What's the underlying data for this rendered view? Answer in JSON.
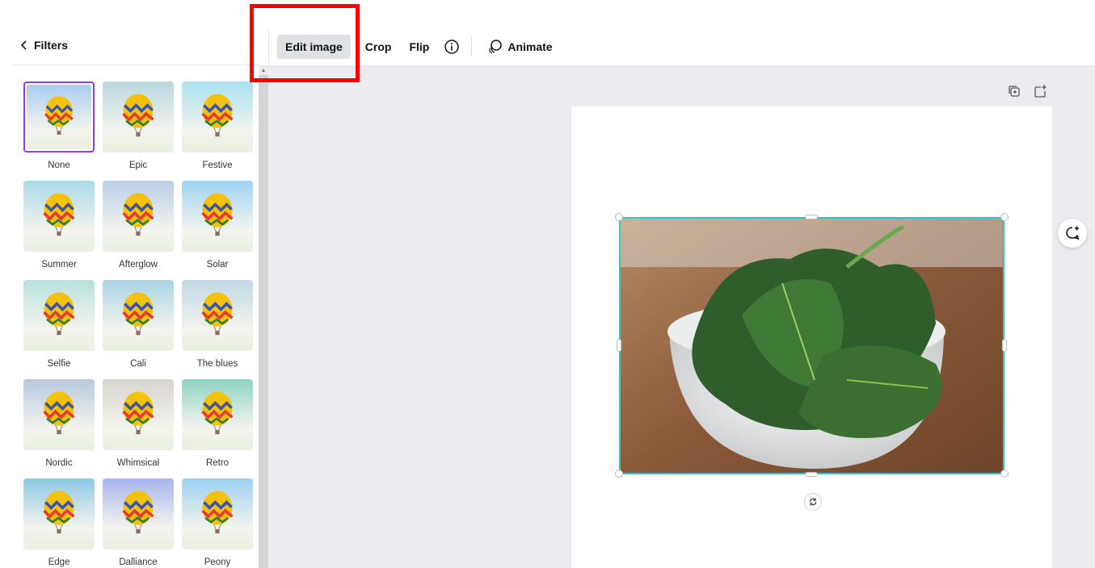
{
  "sidebar": {
    "back_label": "Filters"
  },
  "toolbar": {
    "edit_image": "Edit image",
    "crop": "Crop",
    "flip": "Flip",
    "animate": "Animate"
  },
  "filters": [
    {
      "label": "None",
      "selected": true,
      "tint": "#a9cdf0"
    },
    {
      "label": "Epic",
      "tint": "#b9d6df"
    },
    {
      "label": "Festive",
      "tint": "#a8e0f2"
    },
    {
      "label": "Summer",
      "tint": "#a9d9e8"
    },
    {
      "label": "Afterglow",
      "tint": "#b9cfe8"
    },
    {
      "label": "Solar",
      "tint": "#9dd3f5"
    },
    {
      "label": "Selfie",
      "tint": "#b8e0dc"
    },
    {
      "label": "Cali",
      "tint": "#a9d4e4"
    },
    {
      "label": "The blues",
      "tint": "#c0d8e6"
    },
    {
      "label": "Nordic",
      "tint": "#b8c8e0"
    },
    {
      "label": "Whimsical",
      "tint": "#d8d4d0"
    },
    {
      "label": "Retro",
      "tint": "#8fd3c4"
    },
    {
      "label": "Edge",
      "tint": "#8ec8e4"
    },
    {
      "label": "Dalliance",
      "tint": "#a7b5ee"
    },
    {
      "label": "Peony",
      "tint": "#9bd0f2"
    }
  ],
  "colors": {
    "accent_selection": "#8b3dff",
    "image_selection": "#2fc6c8",
    "highlight": "#ff0000"
  },
  "icons": [
    "chevron-left-icon",
    "info-icon",
    "animate-icon",
    "duplicate-page-icon",
    "add-page-icon",
    "rotate-icon",
    "add-comment-icon"
  ]
}
